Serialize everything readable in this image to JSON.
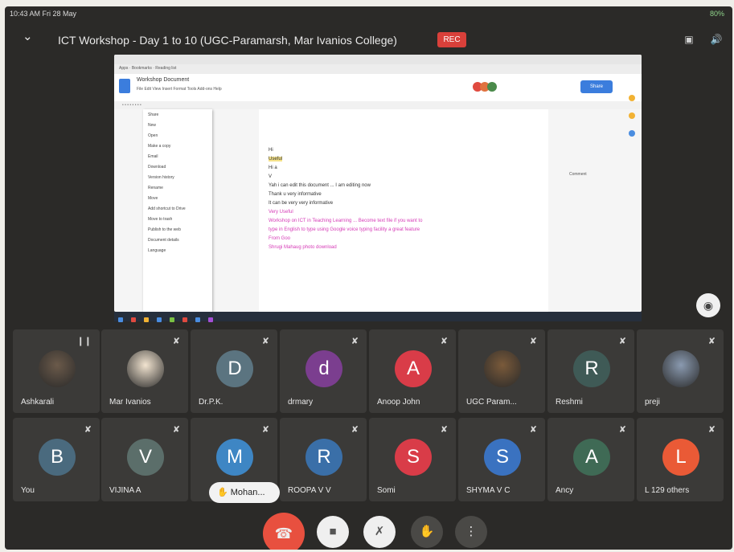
{
  "status_bar": {
    "time": "10:43 AM  Fri 28 May",
    "right": "80%"
  },
  "header": {
    "meeting_title": "ICT Workshop - Day 1 to 10 (UGC-Paramarsh, Mar Ivanios College)",
    "rec_label": "REC"
  },
  "shared_screen": {
    "doc_title": "Workshop Document",
    "menu_bar": "File  Edit  View  Insert  Format  Tools  Add-ons  Help",
    "bookmarks": "Apps  ·  Bookmarks  ·  Reading list",
    "share_label": "Share",
    "file_menu": [
      "Share",
      "New",
      "Open",
      "Make a copy",
      "Email",
      "Download",
      "Version history",
      "Rename",
      "Move",
      "Add shortcut to Drive",
      "Move to trash",
      "Publish to the web",
      "Document details",
      "Language"
    ],
    "doc_lines": [
      {
        "text": "Hi",
        "style": "normal"
      },
      {
        "text": "Useful",
        "style": "hl"
      },
      {
        "text": "Hi a",
        "style": "normal"
      },
      {
        "text": "V",
        "style": "normal"
      },
      {
        "text": "Yah i can edit this document ... I am editing now",
        "style": "normal"
      },
      {
        "text": "Thank u very informative",
        "style": "normal"
      },
      {
        "text": "It can be very very informative",
        "style": "normal"
      },
      {
        "text": "Very Useful",
        "style": "pink"
      },
      {
        "text": "Workshop on ICT in Teaching Learning ... Become text file if you want to",
        "style": "pink"
      },
      {
        "text": "type in English to type using Google voice typing facility a great feature",
        "style": "pink"
      },
      {
        "text": "From Goo",
        "style": "pink"
      },
      {
        "text": "Shrugi Mahaug photo download",
        "style": "pink"
      }
    ],
    "comment_text": "Comment"
  },
  "participants": [
    {
      "name": "Ashkarali",
      "initial": "",
      "color": "#6b5a4a",
      "photo": true,
      "speaking": true
    },
    {
      "name": "Mar Ivanios",
      "initial": "",
      "color": "#f2e4d0",
      "photo": true
    },
    {
      "name": "Dr.P.K.",
      "initial": "D",
      "color": "#5b7480"
    },
    {
      "name": "drmary",
      "initial": "d",
      "color": "#7b3e8f"
    },
    {
      "name": "Anoop John",
      "initial": "A",
      "color": "#d93c48"
    },
    {
      "name": "UGC Param...",
      "initial": "",
      "color": "#7a5a3a",
      "photo": true
    },
    {
      "name": "Reshmi",
      "initial": "R",
      "color": "#3f5a56"
    },
    {
      "name": "preji",
      "initial": "",
      "color": "#8a9ab0",
      "photo": true
    },
    {
      "name": "You",
      "initial": "B",
      "color": "#4a6a7e"
    },
    {
      "name": "VIJINA A",
      "initial": "V",
      "color": "#5b6e6a"
    },
    {
      "name": "Mohan...",
      "initial": "M",
      "color": "#3e86c4"
    },
    {
      "name": "ROOPA V V",
      "initial": "R",
      "color": "#3a6fa8"
    },
    {
      "name": "Somi",
      "initial": "S",
      "color": "#d93c48"
    },
    {
      "name": "SHYMA V C",
      "initial": "S",
      "color": "#3a72c0"
    },
    {
      "name": "Ancy",
      "initial": "A",
      "color": "#3f6a55"
    },
    {
      "name": "L  129 others",
      "initial": "L",
      "color": "#ea5a36"
    }
  ],
  "hand_raised_label": "Mohan...",
  "controls": {
    "end_call": "end-call",
    "camera": "camera-off",
    "mic": "mic-off",
    "raise_hand": "raise-hand",
    "more": "more-options"
  }
}
